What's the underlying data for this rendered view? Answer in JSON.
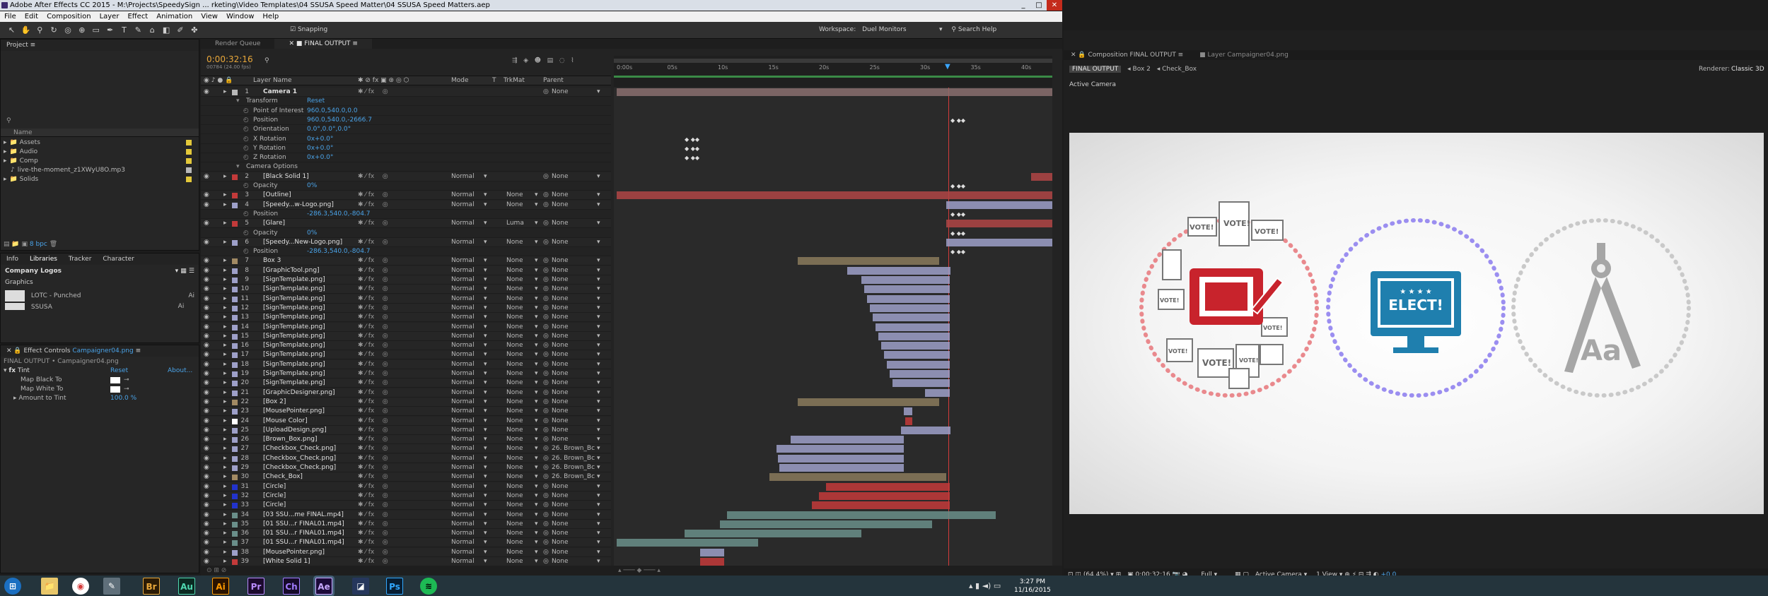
{
  "window": {
    "title": "Adobe After Effects CC 2015 - M:\\Projects\\SpeedySign ... rketing\\Video Templates\\04 SSUSA Speed Matter\\04 SSUSA Speed Matters.aep",
    "min": "_",
    "max": "□",
    "close": "✕"
  },
  "menu": [
    "File",
    "Edit",
    "Composition",
    "Layer",
    "Effect",
    "Animation",
    "View",
    "Window",
    "Help"
  ],
  "toolbar": {
    "snapping": "Snapping",
    "workspace_label": "Workspace:",
    "workspace": "Duel Monitors",
    "search_help": "Search Help"
  },
  "project": {
    "tab": "Project",
    "columns": {
      "name": "Name"
    },
    "items": [
      {
        "name": "Assets",
        "color": "#e3c83a"
      },
      {
        "name": "Audio",
        "color": "#e3c83a"
      },
      {
        "name": "Comp",
        "color": "#e3c83a"
      },
      {
        "name": "live-the-moment_z1XWyU8O.mp3",
        "color": "#b9b9b9"
      },
      {
        "name": "Solids",
        "color": "#e3c83a"
      }
    ],
    "bpc": "8 bpc"
  },
  "libraries": {
    "tabs": [
      "Info",
      "Libraries",
      "Tracker",
      "Character"
    ],
    "library": "Company Logos",
    "section": "Graphics",
    "items": [
      {
        "name": "LOTC - Punched",
        "tag": "Ai"
      },
      {
        "name": "SSUSA",
        "tag": "Ai"
      }
    ]
  },
  "effect_controls": {
    "tab": "Effect Controls",
    "layer": "Campaigner04.png",
    "context": "FINAL OUTPUT • Campaigner04.png",
    "effect": "Tint",
    "reset": "Reset",
    "about": "About...",
    "props": [
      {
        "name": "Map Black To"
      },
      {
        "name": "Map White To"
      },
      {
        "name": "Amount to Tint",
        "value": "100.0 %"
      }
    ]
  },
  "timeline": {
    "tabs": [
      "Render Queue",
      "FINAL OUTPUT"
    ],
    "timecode": "0:00:32:16",
    "timecode_sub": "00784 (24.00 fps)",
    "columns": {
      "layer_name": "Layer Name",
      "mode": "Mode",
      "t": "T",
      "trkmat": "TrkMat",
      "parent": "Parent"
    },
    "ruler": [
      "0:00s",
      "05s",
      "10s",
      "15s",
      "20s",
      "25s",
      "30s",
      "35s",
      "40s"
    ],
    "rows": [
      {
        "num": "1",
        "name": "Camera 1",
        "mode": "",
        "trk": "",
        "parent": "None",
        "c": "#b9b9b9",
        "ind": 0,
        "bold": true
      },
      {
        "num": "",
        "name": "Transform",
        "val": "Reset",
        "ind": 1
      },
      {
        "num": "",
        "name": "Point of Interest",
        "val": "960.0,540.0,0.0",
        "ind": 2
      },
      {
        "num": "",
        "name": "Position",
        "val": "960.0,540.0,-2666.7",
        "ind": 2
      },
      {
        "num": "",
        "name": "Orientation",
        "val": "0.0°,0.0°,0.0°",
        "ind": 2
      },
      {
        "num": "",
        "name": "X Rotation",
        "val": "0x+0.0°",
        "ind": 2
      },
      {
        "num": "",
        "name": "Y Rotation",
        "val": "0x+0.0°",
        "ind": 2
      },
      {
        "num": "",
        "name": "Z Rotation",
        "val": "0x+0.0°",
        "ind": 2
      },
      {
        "num": "",
        "name": "Camera Options",
        "ind": 1
      },
      {
        "num": "2",
        "name": "[Black Solid 1]",
        "mode": "Normal",
        "trk": "",
        "parent": "None",
        "c": "#c33a3a",
        "ind": 0
      },
      {
        "num": "",
        "name": "Opacity",
        "val": "0%",
        "ind": 2
      },
      {
        "num": "3",
        "name": "[Outline]",
        "mode": "Normal",
        "trk": "None",
        "parent": "None",
        "c": "#c33a3a",
        "ind": 0
      },
      {
        "num": "4",
        "name": "[Speedy...w-Logo.png]",
        "mode": "Normal",
        "trk": "None",
        "parent": "None",
        "c": "#9ea0c9",
        "ind": 0
      },
      {
        "num": "",
        "name": "Position",
        "val": "-286.3,540.0,-804.7",
        "ind": 2
      },
      {
        "num": "5",
        "name": "[Glare]",
        "mode": "Normal",
        "trk": "Luma",
        "parent": "None",
        "c": "#c33a3a",
        "ind": 0
      },
      {
        "num": "",
        "name": "Opacity",
        "val": "0%",
        "ind": 2
      },
      {
        "num": "6",
        "name": "[Speedy...New-Logo.png]",
        "mode": "Normal",
        "trk": "None",
        "parent": "None",
        "c": "#9ea0c9",
        "ind": 0
      },
      {
        "num": "",
        "name": "Position",
        "val": "-286.3,540.0,-804.7",
        "ind": 2
      },
      {
        "num": "7",
        "name": "Box 3",
        "mode": "Normal",
        "trk": "None",
        "parent": "None",
        "c": "#a28a64",
        "ind": 0
      },
      {
        "num": "8",
        "name": "[GraphicTool.png]",
        "mode": "Normal",
        "trk": "None",
        "parent": "None",
        "c": "#9ea0c9",
        "ind": 0
      },
      {
        "num": "9",
        "name": "[SignTemplate.png]",
        "mode": "Normal",
        "trk": "None",
        "parent": "None",
        "c": "#9ea0c9",
        "ind": 0
      },
      {
        "num": "10",
        "name": "[SignTemplate.png]",
        "mode": "Normal",
        "trk": "None",
        "parent": "None",
        "c": "#9ea0c9",
        "ind": 0
      },
      {
        "num": "11",
        "name": "[SignTemplate.png]",
        "mode": "Normal",
        "trk": "None",
        "parent": "None",
        "c": "#9ea0c9",
        "ind": 0
      },
      {
        "num": "12",
        "name": "[SignTemplate.png]",
        "mode": "Normal",
        "trk": "None",
        "parent": "None",
        "c": "#9ea0c9",
        "ind": 0
      },
      {
        "num": "13",
        "name": "[SignTemplate.png]",
        "mode": "Normal",
        "trk": "None",
        "parent": "None",
        "c": "#9ea0c9",
        "ind": 0
      },
      {
        "num": "14",
        "name": "[SignTemplate.png]",
        "mode": "Normal",
        "trk": "None",
        "parent": "None",
        "c": "#9ea0c9",
        "ind": 0
      },
      {
        "num": "15",
        "name": "[SignTemplate.png]",
        "mode": "Normal",
        "trk": "None",
        "parent": "None",
        "c": "#9ea0c9",
        "ind": 0
      },
      {
        "num": "16",
        "name": "[SignTemplate.png]",
        "mode": "Normal",
        "trk": "None",
        "parent": "None",
        "c": "#9ea0c9",
        "ind": 0
      },
      {
        "num": "17",
        "name": "[SignTemplate.png]",
        "mode": "Normal",
        "trk": "None",
        "parent": "None",
        "c": "#9ea0c9",
        "ind": 0
      },
      {
        "num": "18",
        "name": "[SignTemplate.png]",
        "mode": "Normal",
        "trk": "None",
        "parent": "None",
        "c": "#9ea0c9",
        "ind": 0
      },
      {
        "num": "19",
        "name": "[SignTemplate.png]",
        "mode": "Normal",
        "trk": "None",
        "parent": "None",
        "c": "#9ea0c9",
        "ind": 0
      },
      {
        "num": "20",
        "name": "[SignTemplate.png]",
        "mode": "Normal",
        "trk": "None",
        "parent": "None",
        "c": "#9ea0c9",
        "ind": 0
      },
      {
        "num": "21",
        "name": "[GraphicDesigner.png]",
        "mode": "Normal",
        "trk": "None",
        "parent": "None",
        "c": "#9ea0c9",
        "ind": 0
      },
      {
        "num": "22",
        "name": "[Box 2]",
        "mode": "Normal",
        "trk": "None",
        "parent": "None",
        "c": "#a28a64",
        "ind": 0
      },
      {
        "num": "23",
        "name": "[MousePointer.png]",
        "mode": "Normal",
        "trk": "None",
        "parent": "None",
        "c": "#9ea0c9",
        "ind": 0
      },
      {
        "num": "24",
        "name": "[Mouse Color]",
        "mode": "Normal",
        "trk": "None",
        "parent": "None",
        "c": "#ffffff",
        "ind": 0
      },
      {
        "num": "25",
        "name": "[UploadDesign.png]",
        "mode": "Normal",
        "trk": "None",
        "parent": "None",
        "c": "#9ea0c9",
        "ind": 0
      },
      {
        "num": "26",
        "name": "[Brown_Box.png]",
        "mode": "Normal",
        "trk": "None",
        "parent": "None",
        "c": "#9ea0c9",
        "ind": 0
      },
      {
        "num": "27",
        "name": "[Checkbox_Check.png]",
        "mode": "Normal",
        "trk": "None",
        "parent": "26. Brown_Bc",
        "c": "#9ea0c9",
        "ind": 0
      },
      {
        "num": "28",
        "name": "[Checkbox_Check.png]",
        "mode": "Normal",
        "trk": "None",
        "parent": "26. Brown_Bc",
        "c": "#9ea0c9",
        "ind": 0
      },
      {
        "num": "29",
        "name": "[Checkbox_Check.png]",
        "mode": "Normal",
        "trk": "None",
        "parent": "26. Brown_Bc",
        "c": "#9ea0c9",
        "ind": 0
      },
      {
        "num": "30",
        "name": "[Check_Box]",
        "mode": "Normal",
        "trk": "None",
        "parent": "26. Brown_Bc",
        "c": "#a28a64",
        "ind": 0
      },
      {
        "num": "31",
        "name": "[Circle]",
        "mode": "Normal",
        "trk": "None",
        "parent": "None",
        "c": "#2233cc",
        "ind": 0
      },
      {
        "num": "32",
        "name": "[Circle]",
        "mode": "Normal",
        "trk": "None",
        "parent": "None",
        "c": "#2233cc",
        "ind": 0
      },
      {
        "num": "33",
        "name": "[Circle]",
        "mode": "Normal",
        "trk": "None",
        "parent": "None",
        "c": "#2233cc",
        "ind": 0
      },
      {
        "num": "34",
        "name": "[03 SSU...me FINAL.mp4]",
        "mode": "Normal",
        "trk": "None",
        "parent": "None",
        "c": "#6a8f8a",
        "ind": 0
      },
      {
        "num": "35",
        "name": "[01 SSU...r FINAL01.mp4]",
        "mode": "Normal",
        "trk": "None",
        "parent": "None",
        "c": "#6a8f8a",
        "ind": 0
      },
      {
        "num": "36",
        "name": "[01 SSU...r FINAL01.mp4]",
        "mode": "Normal",
        "trk": "None",
        "parent": "None",
        "c": "#6a8f8a",
        "ind": 0
      },
      {
        "num": "37",
        "name": "[01 SSU...r FINAL01.mp4]",
        "mode": "Normal",
        "trk": "None",
        "parent": "None",
        "c": "#6a8f8a",
        "ind": 0
      },
      {
        "num": "38",
        "name": "[MousePointer.png]",
        "mode": "Normal",
        "trk": "None",
        "parent": "None",
        "c": "#9ea0c9",
        "ind": 0
      },
      {
        "num": "39",
        "name": "[White Solid 1]",
        "mode": "Normal",
        "trk": "None",
        "parent": "None",
        "c": "#c33a3a",
        "ind": 0
      }
    ]
  },
  "viewer": {
    "tabs": [
      "Composition FINAL OUTPUT",
      "Layer Campaigner04.png"
    ],
    "nav": [
      "FINAL OUTPUT",
      "Box 2",
      "Check_Box"
    ],
    "renderer": "Renderer:",
    "renderer_value": "Classic 3D",
    "active_camera": "Active Camera",
    "zoom": "(64.4%)",
    "timecode": "0:00:32:16",
    "resolution": "Full",
    "camera": "Active Camera",
    "views": "1 View",
    "exposure": "+0.0",
    "graphics": {
      "vote_labels": [
        "VOTE!",
        "VOTE!",
        "VOTE!",
        "VOTE!",
        "VOTE!",
        "VOTE!",
        "VOTE!",
        "VOTE!"
      ],
      "elect_label": "ELECT!",
      "aa_label": "Aa",
      "colors": {
        "red": "#c8232c",
        "blue": "#1f7fae",
        "gray": "#a6a6a6"
      }
    }
  },
  "taskbar": {
    "apps": [
      "Br",
      "Au",
      "Ai",
      "Pr",
      "Ch",
      "Ae",
      "Ps"
    ],
    "time": "3:27 PM",
    "date": "11/16/2015"
  }
}
